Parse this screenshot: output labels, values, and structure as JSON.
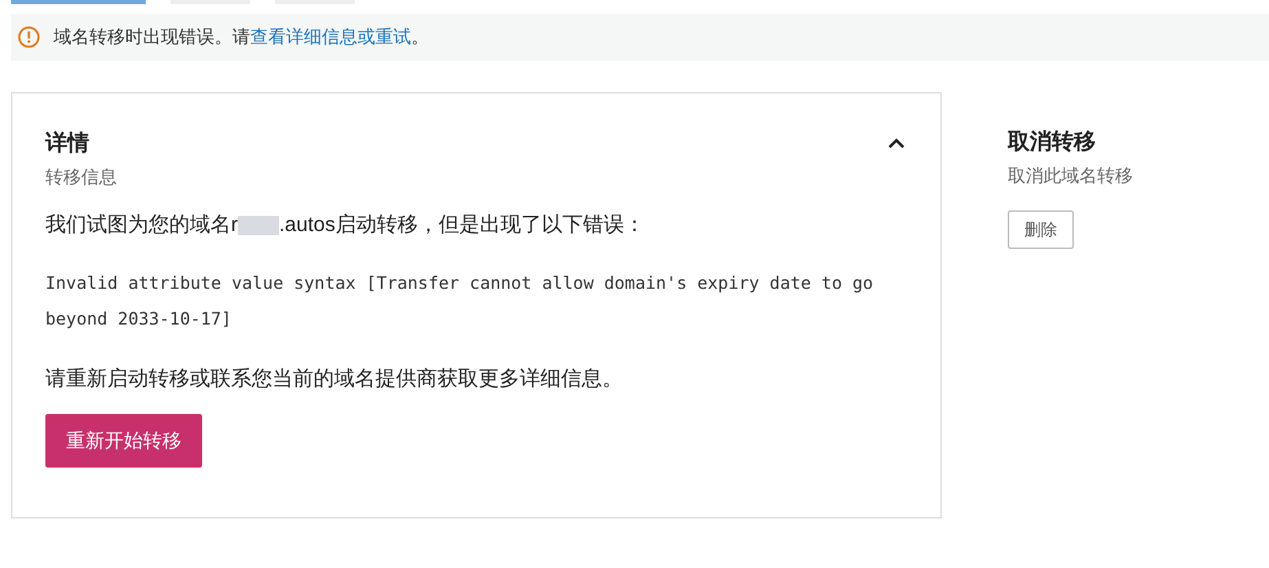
{
  "tabs": [
    {
      "selected": true
    },
    {
      "selected": false
    },
    {
      "selected": false
    }
  ],
  "alert": {
    "text": "域名转移时出现错误。请",
    "link": "查看详细信息或重试",
    "end": "。"
  },
  "details": {
    "title": "详情",
    "subtitle": "转移信息",
    "expanded": true,
    "message_start": "我们试图为您的域名r",
    "message_end": ".autos启动转移，但是出现了以下错误：",
    "error": "Invalid attribute value syntax [Transfer cannot allow domain's expiry date to go beyond 2033-10-17]",
    "hint": "请重新启动转移或联系您当前的域名提供商获取更多详细信息。",
    "button": "重新开始转移"
  },
  "cancel": {
    "title": "取消转移",
    "subtitle": "取消此域名转移",
    "button": "删除"
  }
}
